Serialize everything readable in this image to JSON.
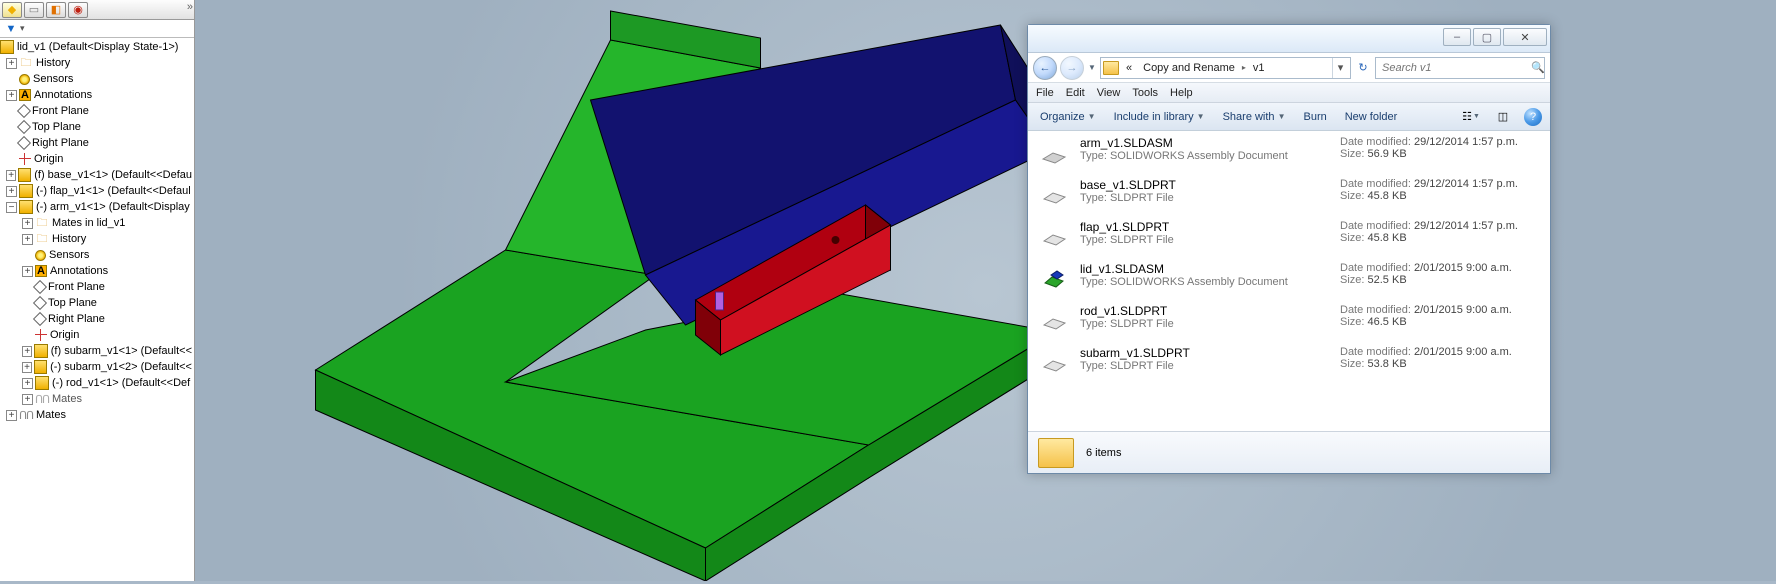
{
  "sw": {
    "root": "lid_v1  (Default<Display State-1>)",
    "history": "History",
    "sensors": "Sensors",
    "annotations": "Annotations",
    "front": "Front Plane",
    "top": "Top Plane",
    "right": "Right Plane",
    "origin": "Origin",
    "base": "(f) base_v1<1> (Default<<Defau",
    "flap": "(-) flap_v1<1> (Default<<Defaul",
    "arm": "(-) arm_v1<1> (Default<Display",
    "arm_mates_in": "Mates in lid_v1",
    "arm_history": "History",
    "arm_sensors": "Sensors",
    "arm_ann": "Annotations",
    "arm_front": "Front Plane",
    "arm_top": "Top Plane",
    "arm_right": "Right Plane",
    "arm_origin": "Origin",
    "subarm1": "(f) subarm_v1<1> (Default<<",
    "subarm2": "(-) subarm_v1<2> (Default<<",
    "rod": "(-) rod_v1<1> (Default<<Def",
    "arm_mates": "Mates",
    "mates": "Mates"
  },
  "explorer": {
    "crumb_pre": "«",
    "crumb1": "Copy and Rename",
    "crumb2": "v1",
    "search_ph": "Search v1",
    "menu": {
      "file": "File",
      "edit": "Edit",
      "view": "View",
      "tools": "Tools",
      "help": "Help"
    },
    "tool": {
      "organize": "Organize",
      "include": "Include in library",
      "share": "Share with",
      "burn": "Burn",
      "newf": "New folder"
    },
    "files": [
      {
        "name": "arm_v1.SLDASM",
        "type": "Type: SOLIDWORKS Assembly Document",
        "date": "29/12/2014 1:57 p.m.",
        "size": "56.9 KB",
        "kind": "asm"
      },
      {
        "name": "base_v1.SLDPRT",
        "type": "Type: SLDPRT File",
        "date": "29/12/2014 1:57 p.m.",
        "size": "45.8 KB",
        "kind": "prt"
      },
      {
        "name": "flap_v1.SLDPRT",
        "type": "Type: SLDPRT File",
        "date": "29/12/2014 1:57 p.m.",
        "size": "45.8 KB",
        "kind": "prt"
      },
      {
        "name": "lid_v1.SLDASM",
        "type": "Type: SOLIDWORKS Assembly Document",
        "date": "2/01/2015 9:00 a.m.",
        "size": "52.5 KB",
        "kind": "asm2"
      },
      {
        "name": "rod_v1.SLDPRT",
        "type": "Type: SLDPRT File",
        "date": "2/01/2015 9:00 a.m.",
        "size": "46.5 KB",
        "kind": "prt"
      },
      {
        "name": "subarm_v1.SLDPRT",
        "type": "Type: SLDPRT File",
        "date": "2/01/2015 9:00 a.m.",
        "size": "53.8 KB",
        "kind": "prt"
      }
    ],
    "status": "6 items",
    "date_label": "Date modified:",
    "size_label": "Size:"
  }
}
